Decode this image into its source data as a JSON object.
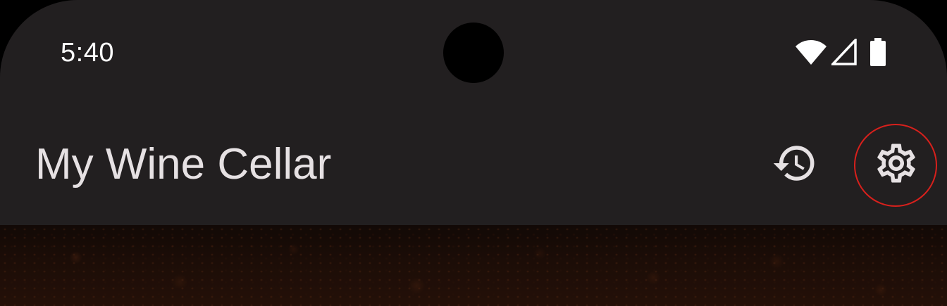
{
  "status_bar": {
    "time": "5:40",
    "icons": [
      "wifi-icon",
      "cellular-signal-icon",
      "battery-icon"
    ]
  },
  "app_bar": {
    "title": "My Wine Cellar",
    "actions": [
      {
        "icon": "history-icon"
      },
      {
        "icon": "settings-icon",
        "highlighted": true
      }
    ]
  },
  "colors": {
    "app_bar_background": "#221f20",
    "title_text": "#e6e1e3",
    "icon": "#e6e1e3",
    "highlight_ring": "#d8201c",
    "content_background": "#1c0d07"
  }
}
